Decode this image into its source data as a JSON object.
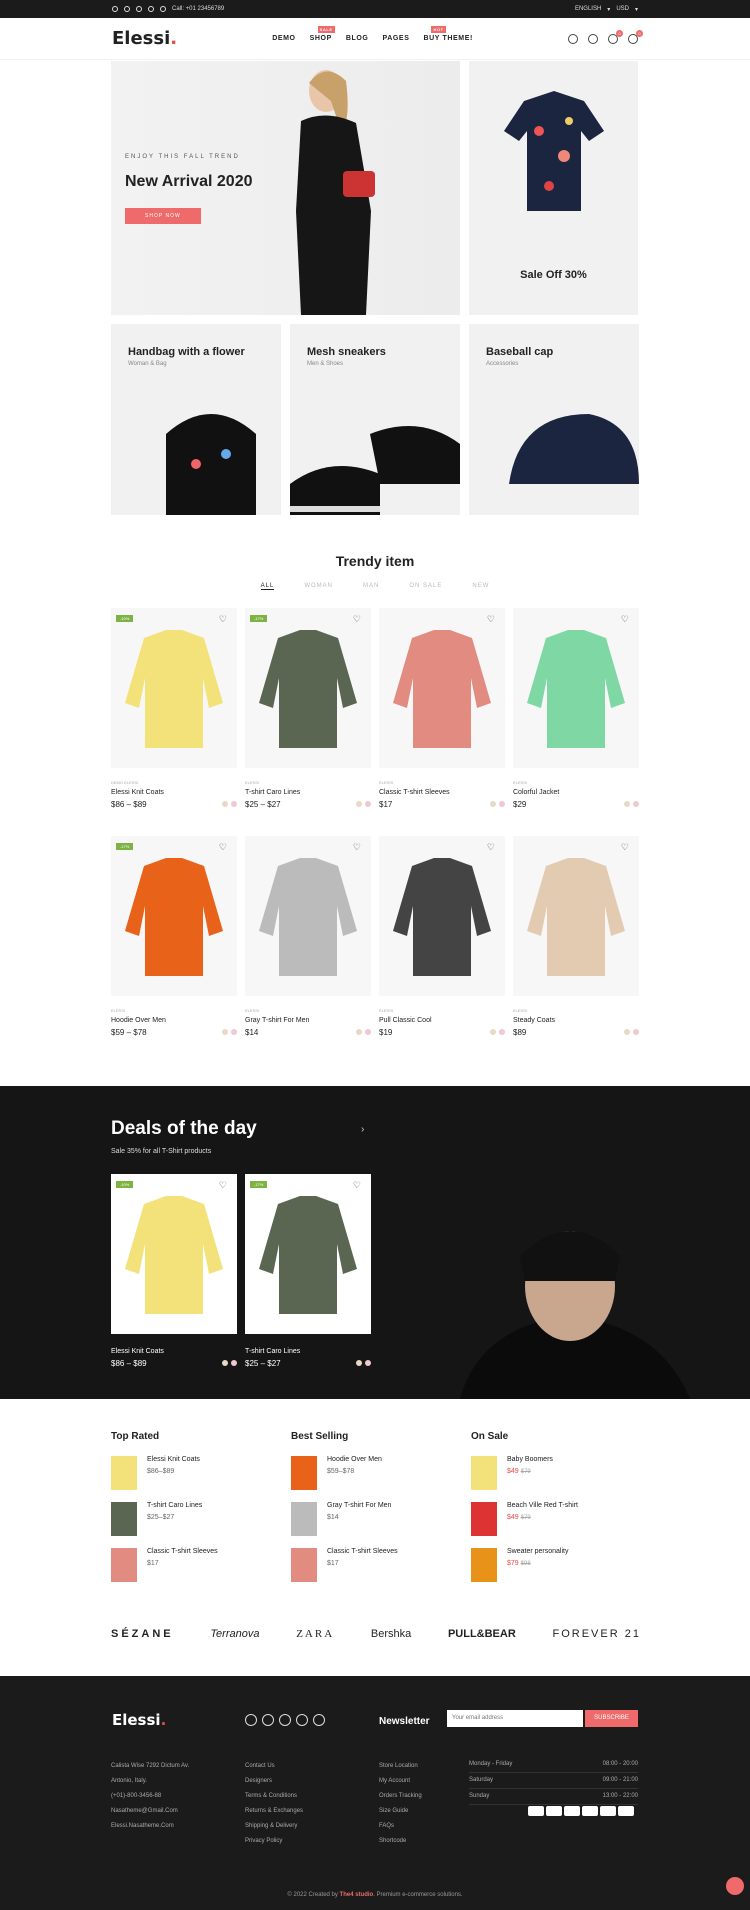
{
  "topbar": {
    "phone": "Call: +01 23456789",
    "lang": "ENGLISH",
    "currency": "USD"
  },
  "header": {
    "logo": "Elessi",
    "nav": [
      "DEMO",
      "SHOP",
      "BLOG",
      "PAGES",
      "BUY THEME!"
    ],
    "badges": {
      "shop": "SALE",
      "buy": "HOT"
    },
    "wishlist_count": "0",
    "cart_count": "0"
  },
  "hero": {
    "sub": "ENJOY THIS FALL TREND",
    "title": "New Arrival 2020",
    "button": "SHOP NOW"
  },
  "side": {
    "caption": "Sale Off 30%"
  },
  "cats": [
    {
      "title": "Handbag with a flower",
      "sub": "Woman & Bag"
    },
    {
      "title": "Mesh sneakers",
      "sub": "Men & Shoes"
    },
    {
      "title": "Baseball cap",
      "sub": "Accessories"
    }
  ],
  "trendy": {
    "title": "Trendy item",
    "filters": [
      "ALL",
      "WOMAN",
      "MAN",
      "ON SALE",
      "NEW"
    ]
  },
  "products": [
    {
      "brand": "DEMO ELESSI",
      "name": "Elessi Knit Coats",
      "price": "$86 – $89",
      "disc": "-10%",
      "color": "#f3e27a"
    },
    {
      "brand": "ELESSI",
      "name": "T-shirt Caro Lines",
      "price": "$25 – $27",
      "disc": "-17%",
      "color": "#5a6652"
    },
    {
      "brand": "ELESSI",
      "name": "Classic T-shirt Sleeves",
      "price": "$17",
      "disc": "",
      "color": "#e28b80"
    },
    {
      "brand": "ELESSI",
      "name": "Colorful Jacket",
      "price": "$29",
      "disc": "",
      "color": "#7fd8a4"
    },
    {
      "brand": "ELESSI",
      "name": "Hoodie Over Men",
      "price": "$59 – $78",
      "disc": "-17%",
      "color": "#e8621a"
    },
    {
      "brand": "ELESSI",
      "name": "Gray T-shirt For Men",
      "price": "$14",
      "disc": "",
      "color": "#bbbbbb"
    },
    {
      "brand": "ELESSI",
      "name": "Pull Classic Cool",
      "price": "$19",
      "disc": "",
      "color": "#444444"
    },
    {
      "brand": "ELESSI",
      "name": "Steady Coats",
      "price": "$89",
      "disc": "",
      "color": "#e3cbb1"
    }
  ],
  "deals": {
    "title": "Deals of the day",
    "sub": "Sale 35% for all T-Shirt products",
    "items": [
      {
        "name": "Elessi Knit Coats",
        "price": "$86 – $89",
        "disc": "-10%",
        "color": "#f3e27a"
      },
      {
        "name": "T-shirt Caro Lines",
        "price": "$25 – $27",
        "disc": "-17%",
        "color": "#5a6652"
      }
    ]
  },
  "lists": [
    {
      "title": "Top Rated",
      "items": [
        {
          "name": "Elessi Knit Coats",
          "price": "$86–$89"
        },
        {
          "name": "T-shirt Caro Lines",
          "price": "$25–$27"
        },
        {
          "name": "Classic T-shirt Sleeves",
          "price": "$17"
        }
      ]
    },
    {
      "title": "Best Selling",
      "items": [
        {
          "name": "Hoodie Over Men",
          "price": "$59–$78"
        },
        {
          "name": "Gray T-shirt For Men",
          "price": "$14"
        },
        {
          "name": "Classic T-shirt Sleeves",
          "price": "$17"
        }
      ]
    },
    {
      "title": "On Sale",
      "items": [
        {
          "name": "Baby Boomers",
          "new": "$49",
          "old": "$79"
        },
        {
          "name": "Beach Ville Red T-shirt",
          "new": "$49",
          "old": "$79"
        },
        {
          "name": "Sweater personality",
          "new": "$79",
          "old": "$98"
        }
      ]
    }
  ],
  "brands": [
    "SÉZANE",
    "Terranova",
    "ZARA",
    "Bershka",
    "PULL&BEAR",
    "FOREVER 21"
  ],
  "footer": {
    "logo": "Elessi",
    "newsletter": "Newsletter",
    "placeholder": "Your email address",
    "subscribe": "SUBSCRIBE",
    "address": [
      "Calista Wise 7292 Dictum Av.",
      "Antonio, Italy.",
      "(+01)-800-3456-88",
      "Nasatheme@Gmail.Com",
      "Elessi.Nasatheme.Com"
    ],
    "links1": [
      "Contact Us",
      "Designers",
      "Terms & Conditions",
      "Returns & Exchanges",
      "Shipping & Delivery",
      "Privacy Policy"
    ],
    "links2": [
      "Store Location",
      "My Account",
      "Orders Tracking",
      "Size Guide",
      "FAQs",
      "Shortcode"
    ],
    "hours": [
      [
        "Monday - Friday",
        "08:00 - 20:00"
      ],
      [
        "Saturday",
        "09:00 - 21:00"
      ],
      [
        "Sunday",
        "13:00 - 22:00"
      ]
    ],
    "copy_pre": "© 2022 Created by ",
    "copy_brand": "The4 studio",
    "copy_post": ". Premium e-commerce solutions."
  }
}
